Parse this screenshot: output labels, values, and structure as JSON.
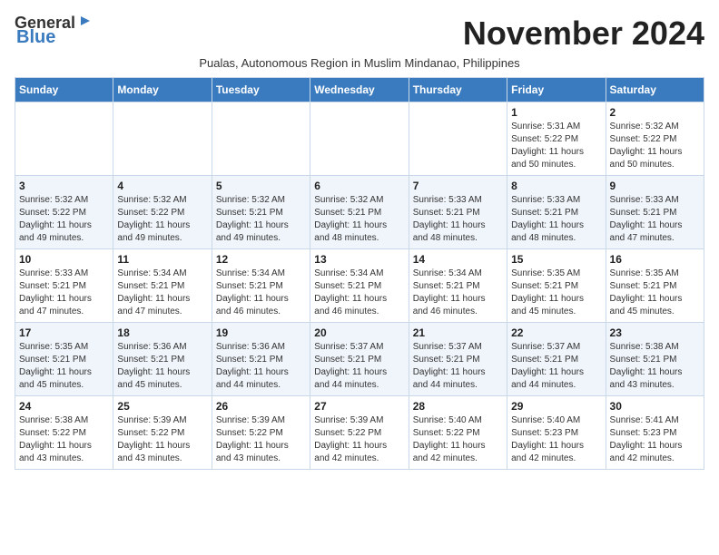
{
  "header": {
    "logo_line1": "General",
    "logo_line2": "Blue",
    "month_title": "November 2024",
    "subtitle": "Pualas, Autonomous Region in Muslim Mindanao, Philippines"
  },
  "weekdays": [
    "Sunday",
    "Monday",
    "Tuesday",
    "Wednesday",
    "Thursday",
    "Friday",
    "Saturday"
  ],
  "weeks": [
    [
      {
        "day": "",
        "info": ""
      },
      {
        "day": "",
        "info": ""
      },
      {
        "day": "",
        "info": ""
      },
      {
        "day": "",
        "info": ""
      },
      {
        "day": "",
        "info": ""
      },
      {
        "day": "1",
        "info": "Sunrise: 5:31 AM\nSunset: 5:22 PM\nDaylight: 11 hours\nand 50 minutes."
      },
      {
        "day": "2",
        "info": "Sunrise: 5:32 AM\nSunset: 5:22 PM\nDaylight: 11 hours\nand 50 minutes."
      }
    ],
    [
      {
        "day": "3",
        "info": "Sunrise: 5:32 AM\nSunset: 5:22 PM\nDaylight: 11 hours\nand 49 minutes."
      },
      {
        "day": "4",
        "info": "Sunrise: 5:32 AM\nSunset: 5:22 PM\nDaylight: 11 hours\nand 49 minutes."
      },
      {
        "day": "5",
        "info": "Sunrise: 5:32 AM\nSunset: 5:21 PM\nDaylight: 11 hours\nand 49 minutes."
      },
      {
        "day": "6",
        "info": "Sunrise: 5:32 AM\nSunset: 5:21 PM\nDaylight: 11 hours\nand 48 minutes."
      },
      {
        "day": "7",
        "info": "Sunrise: 5:33 AM\nSunset: 5:21 PM\nDaylight: 11 hours\nand 48 minutes."
      },
      {
        "day": "8",
        "info": "Sunrise: 5:33 AM\nSunset: 5:21 PM\nDaylight: 11 hours\nand 48 minutes."
      },
      {
        "day": "9",
        "info": "Sunrise: 5:33 AM\nSunset: 5:21 PM\nDaylight: 11 hours\nand 47 minutes."
      }
    ],
    [
      {
        "day": "10",
        "info": "Sunrise: 5:33 AM\nSunset: 5:21 PM\nDaylight: 11 hours\nand 47 minutes."
      },
      {
        "day": "11",
        "info": "Sunrise: 5:34 AM\nSunset: 5:21 PM\nDaylight: 11 hours\nand 47 minutes."
      },
      {
        "day": "12",
        "info": "Sunrise: 5:34 AM\nSunset: 5:21 PM\nDaylight: 11 hours\nand 46 minutes."
      },
      {
        "day": "13",
        "info": "Sunrise: 5:34 AM\nSunset: 5:21 PM\nDaylight: 11 hours\nand 46 minutes."
      },
      {
        "day": "14",
        "info": "Sunrise: 5:34 AM\nSunset: 5:21 PM\nDaylight: 11 hours\nand 46 minutes."
      },
      {
        "day": "15",
        "info": "Sunrise: 5:35 AM\nSunset: 5:21 PM\nDaylight: 11 hours\nand 45 minutes."
      },
      {
        "day": "16",
        "info": "Sunrise: 5:35 AM\nSunset: 5:21 PM\nDaylight: 11 hours\nand 45 minutes."
      }
    ],
    [
      {
        "day": "17",
        "info": "Sunrise: 5:35 AM\nSunset: 5:21 PM\nDaylight: 11 hours\nand 45 minutes."
      },
      {
        "day": "18",
        "info": "Sunrise: 5:36 AM\nSunset: 5:21 PM\nDaylight: 11 hours\nand 45 minutes."
      },
      {
        "day": "19",
        "info": "Sunrise: 5:36 AM\nSunset: 5:21 PM\nDaylight: 11 hours\nand 44 minutes."
      },
      {
        "day": "20",
        "info": "Sunrise: 5:37 AM\nSunset: 5:21 PM\nDaylight: 11 hours\nand 44 minutes."
      },
      {
        "day": "21",
        "info": "Sunrise: 5:37 AM\nSunset: 5:21 PM\nDaylight: 11 hours\nand 44 minutes."
      },
      {
        "day": "22",
        "info": "Sunrise: 5:37 AM\nSunset: 5:21 PM\nDaylight: 11 hours\nand 44 minutes."
      },
      {
        "day": "23",
        "info": "Sunrise: 5:38 AM\nSunset: 5:21 PM\nDaylight: 11 hours\nand 43 minutes."
      }
    ],
    [
      {
        "day": "24",
        "info": "Sunrise: 5:38 AM\nSunset: 5:22 PM\nDaylight: 11 hours\nand 43 minutes."
      },
      {
        "day": "25",
        "info": "Sunrise: 5:39 AM\nSunset: 5:22 PM\nDaylight: 11 hours\nand 43 minutes."
      },
      {
        "day": "26",
        "info": "Sunrise: 5:39 AM\nSunset: 5:22 PM\nDaylight: 11 hours\nand 43 minutes."
      },
      {
        "day": "27",
        "info": "Sunrise: 5:39 AM\nSunset: 5:22 PM\nDaylight: 11 hours\nand 42 minutes."
      },
      {
        "day": "28",
        "info": "Sunrise: 5:40 AM\nSunset: 5:22 PM\nDaylight: 11 hours\nand 42 minutes."
      },
      {
        "day": "29",
        "info": "Sunrise: 5:40 AM\nSunset: 5:23 PM\nDaylight: 11 hours\nand 42 minutes."
      },
      {
        "day": "30",
        "info": "Sunrise: 5:41 AM\nSunset: 5:23 PM\nDaylight: 11 hours\nand 42 minutes."
      }
    ]
  ]
}
